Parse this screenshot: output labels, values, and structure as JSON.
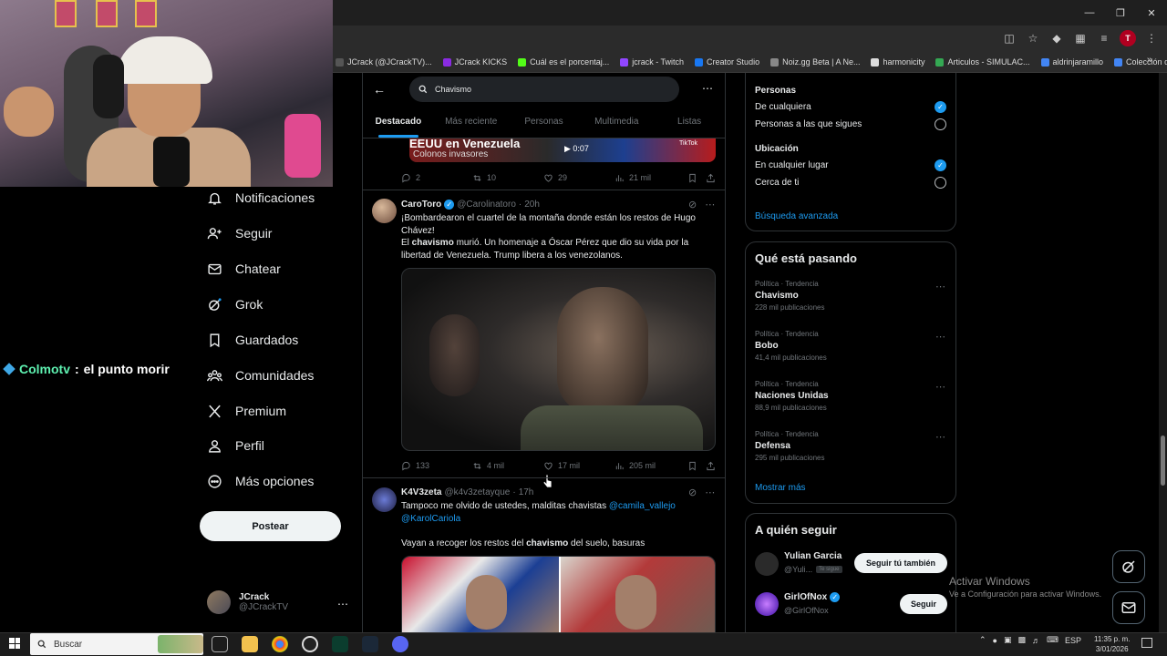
{
  "browser": {
    "bookmarks": [
      {
        "label": "JCrack (@JCrackTV)...",
        "color": "#555"
      },
      {
        "label": "JCrack KICKS",
        "color": "#8a2be2"
      },
      {
        "label": "Cuál es el porcentaj...",
        "color": "#53fc18"
      },
      {
        "label": "jcrack - Twitch",
        "color": "#9146ff"
      },
      {
        "label": "Creator Studio",
        "color": "#1877f2"
      },
      {
        "label": "Noiz.gg Beta | A Ne...",
        "color": "#888"
      },
      {
        "label": "harmonicity",
        "color": "#ddd"
      },
      {
        "label": "Articulos - SIMULAC...",
        "color": "#34a853"
      },
      {
        "label": "aldrinjaramillo",
        "color": "#4285f4"
      },
      {
        "label": "Colección de M_blei...",
        "color": "#4285f4"
      }
    ],
    "profile_initial": "T"
  },
  "stream": {
    "chat_user": "Colmotv",
    "chat_sep": " : ",
    "chat_message": "el punto morir"
  },
  "nav": {
    "items": [
      {
        "label": "Notificaciones",
        "icon": "bell-icon"
      },
      {
        "label": "Seguir",
        "icon": "add-user-icon"
      },
      {
        "label": "Chatear",
        "icon": "mail-icon"
      },
      {
        "label": "Grok",
        "icon": "grok-icon"
      },
      {
        "label": "Guardados",
        "icon": "bookmark-icon"
      },
      {
        "label": "Comunidades",
        "icon": "communities-icon"
      },
      {
        "label": "Premium",
        "icon": "x-logo-icon"
      },
      {
        "label": "Perfil",
        "icon": "profile-icon"
      },
      {
        "label": "Más opciones",
        "icon": "more-options-icon"
      }
    ],
    "post_label": "Postear",
    "account_name": "JCrack",
    "account_handle": "@JCrackTV"
  },
  "search": {
    "query": "Chavismo",
    "tabs": [
      "Destacado",
      "Más reciente",
      "Personas",
      "Multimedia",
      "Listas"
    ],
    "active_tab": "Destacado"
  },
  "tweets": [
    {
      "video_title": "EEUU en Venezuela",
      "video_subtitle": "Colonos invasores",
      "video_time": "0:07",
      "video_brand": "TikTok",
      "replies": "2",
      "reposts": "10",
      "likes": "29",
      "views": "21 mil"
    },
    {
      "name": "CaroToro",
      "handle": "@Carolinatoro",
      "time": "20h",
      "text1": "¡Bombardearon el cuartel de la montaña donde están los restos de Hugo Chávez!",
      "text2_pre": "El ",
      "text2_kw": "chavismo",
      "text2_post": " murió. Un homenaje a Óscar Pérez que dio su vida por la libertad de Venezuela.  Trump libera a los venezolanos.",
      "replies": "133",
      "reposts": "4 mil",
      "likes": "17 mil",
      "views": "205 mil"
    },
    {
      "name": "K4V3zeta",
      "handle": "@k4v3zetayque",
      "time": "17h",
      "text1": "Tampoco me olvido de ustedes, malditas chavistas ",
      "mention1": "@camila_vallejo",
      "mention2": "@KarolCariola",
      "text2_pre": "Vayan a recoger los restos del ",
      "text2_kw": "chavismo",
      "text2_post": " del suelo, basuras"
    }
  ],
  "filters": {
    "people_title": "Personas",
    "people_opt1": "De cualquiera",
    "people_opt2": "Personas a las que sigues",
    "people_selected": 1,
    "location_title": "Ubicación",
    "location_opt1": "En cualquier lugar",
    "location_opt2": "Cerca de ti",
    "location_selected": 1,
    "advanced": "Búsqueda avanzada"
  },
  "trends": {
    "title": "Qué está pasando",
    "items": [
      {
        "category": "Política · Tendencia",
        "name": "Chavismo",
        "count": "228 mil publicaciones"
      },
      {
        "category": "Política · Tendencia",
        "name": "Bobo",
        "count": "41,4 mil publicaciones"
      },
      {
        "category": "Política · Tendencia",
        "name": "Naciones Unidas",
        "count": "88,9 mil publicaciones"
      },
      {
        "category": "Política · Tendencia",
        "name": "Defensa",
        "count": "295 mil publicaciones"
      }
    ],
    "show_more": "Mostrar más"
  },
  "follow": {
    "title": "A quién seguir",
    "items": [
      {
        "name": "Yulian Garcia",
        "handle": "@Yuli...",
        "tag": "Te sigue",
        "button": "Seguir tú también"
      },
      {
        "name": "GirlOfNox",
        "handle": "@GirlOfNox",
        "button": "Seguir"
      }
    ]
  },
  "watermark": {
    "line1": "Activar Windows",
    "line2": "Ve a Configuración para activar Windows."
  },
  "taskbar": {
    "search_placeholder": "Buscar",
    "lang": "ESP",
    "time": "11:35 p. m.",
    "date": "3/01/2026"
  }
}
